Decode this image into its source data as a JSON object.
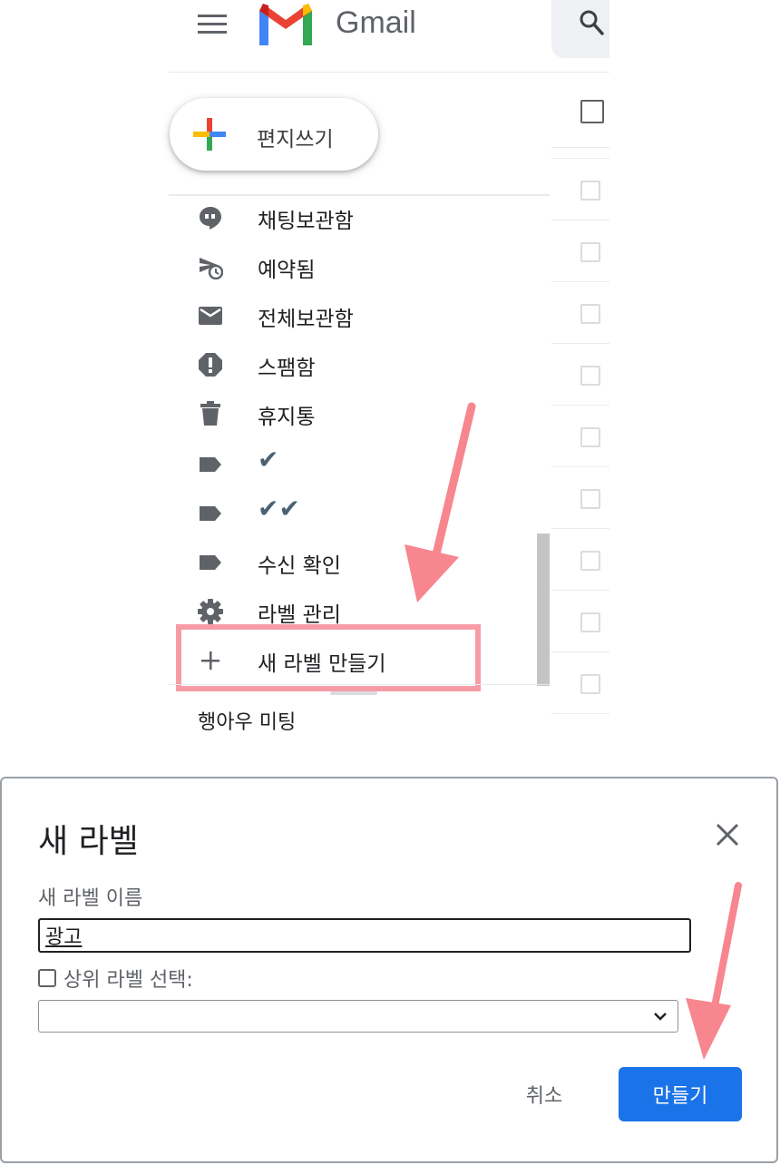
{
  "header": {
    "brand": "Gmail",
    "menu_icon": "hamburger-menu-icon",
    "search_icon": "search-icon"
  },
  "compose": {
    "label": "편지쓰기",
    "icon": "plus-colorful-icon"
  },
  "sidebar": {
    "items": [
      {
        "label": "채팅보관함",
        "icon": "chat-bubble-icon"
      },
      {
        "label": "예약됨",
        "icon": "scheduled-send-icon"
      },
      {
        "label": "전체보관함",
        "icon": "envelope-icon"
      },
      {
        "label": "스팸함",
        "icon": "spam-alert-icon"
      },
      {
        "label": "휴지통",
        "icon": "trash-icon"
      },
      {
        "label": "✔",
        "icon": "label-tag-icon"
      },
      {
        "label": "✔✔",
        "icon": "label-tag-icon"
      },
      {
        "label": "수신 확인",
        "icon": "label-tag-icon"
      },
      {
        "label": "라벨 관리",
        "icon": "gear-icon"
      },
      {
        "label": "새 라벨 만들기",
        "icon": "plus-icon"
      }
    ],
    "hangouts_label": "행아우 미팅"
  },
  "dialog": {
    "title": "새 라벨",
    "name_label": "새 라벨 이름",
    "name_value": "광고",
    "parent_checkbox_label": "상위 라벨 선택:",
    "parent_checked": false,
    "parent_select_value": "",
    "cancel_label": "취소",
    "create_label": "만들기"
  },
  "colors": {
    "accent_blue": "#1a73e8",
    "annotation_pink": "#f79ca6",
    "icon_gray": "#5f6368"
  }
}
